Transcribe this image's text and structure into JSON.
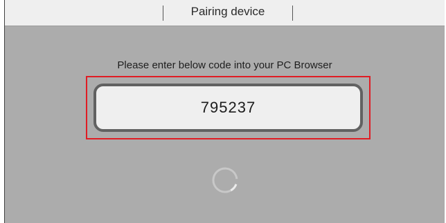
{
  "header": {
    "title": "Pairing device"
  },
  "main": {
    "instruction": "Please enter below code into your PC Browser",
    "pairing_code": "795237"
  },
  "loading": {
    "icon": "loading-spinner-icon"
  },
  "colors": {
    "highlight": "#e01c24",
    "background": "#acacac",
    "header_background": "#efefef"
  }
}
